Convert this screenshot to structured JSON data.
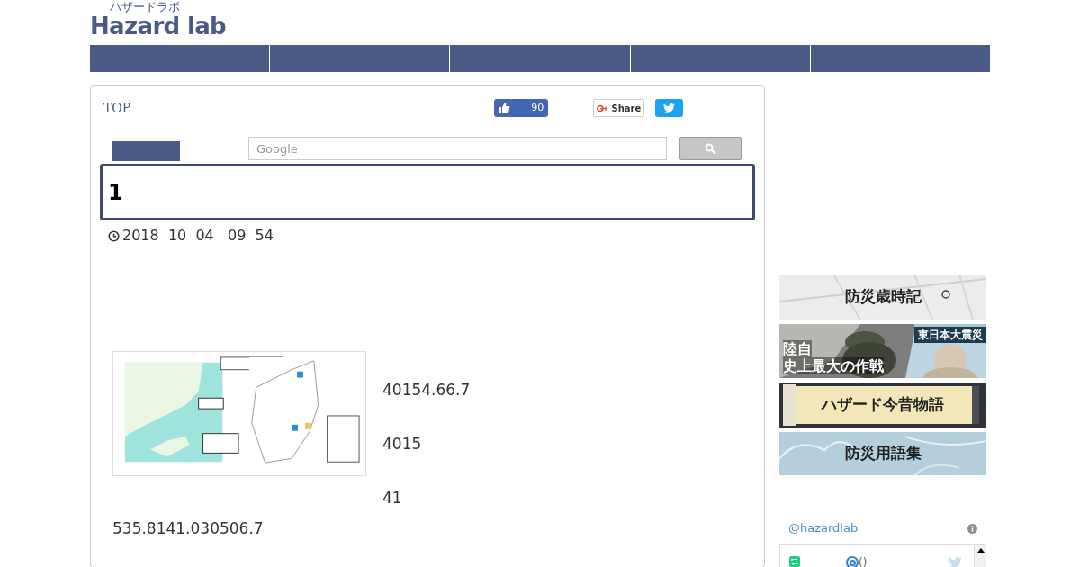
{
  "logo": {
    "kana": "ハザードラボ",
    "name": "Hazard lab"
  },
  "breadcrumb": "TOP",
  "social": {
    "like_count": "90",
    "share": "Share"
  },
  "search": {
    "placeholder": "Google"
  },
  "article": {
    "title": "1",
    "date": "2018  10  04   09  54",
    "paragraphs": [
      "40154.66.7",
      "4015",
      "41"
    ],
    "footer_text": "535.8141.030506.7"
  },
  "banners": [
    {
      "text": "防災歳時記"
    },
    {
      "lines": [
        "陸自",
        "史上最大の作戦"
      ],
      "tag": "東日本大震災"
    },
    {
      "text": "ハザード今昔物語"
    },
    {
      "text": "防災用語集"
    }
  ],
  "twitter_widget": {
    "handle": "@hazardlab",
    "item_text": "()"
  }
}
